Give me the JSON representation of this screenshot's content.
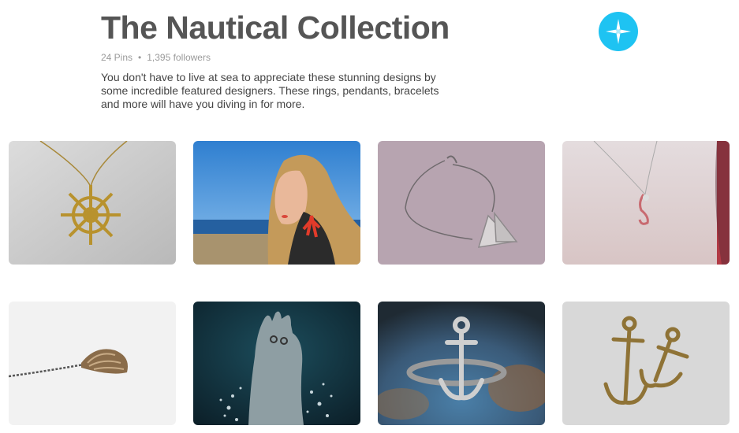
{
  "board": {
    "title": "The Nautical Collection",
    "pins_count": "24 Pins",
    "separator": "•",
    "followers": "1,395 followers",
    "description": "You don't have to live at sea to appreciate these stunning designs by some incredible featured designers. These rings, pendants, bracelets and more will have you diving in for more."
  },
  "profile": {
    "icon": "star-compass-icon",
    "color": "#1ec3f2"
  },
  "pins": [
    {
      "name": "ship-wheel-necklace-pin",
      "icon": "ship-wheel-pendant"
    },
    {
      "name": "coral-earring-model-pin",
      "icon": "woman-coral-earring"
    },
    {
      "name": "sailboat-necklace-pin",
      "icon": "sailboat-pendant"
    },
    {
      "name": "seahorse-necklace-pin",
      "icon": "seahorse-pendant"
    },
    {
      "name": "shell-pendant-pin",
      "icon": "shell-pendant"
    },
    {
      "name": "hand-rings-water-pin",
      "icon": "hand-splash-rings"
    },
    {
      "name": "anchor-ring-pin",
      "icon": "anchor-ring"
    },
    {
      "name": "anchor-charms-pin",
      "icon": "anchor-charms"
    }
  ]
}
